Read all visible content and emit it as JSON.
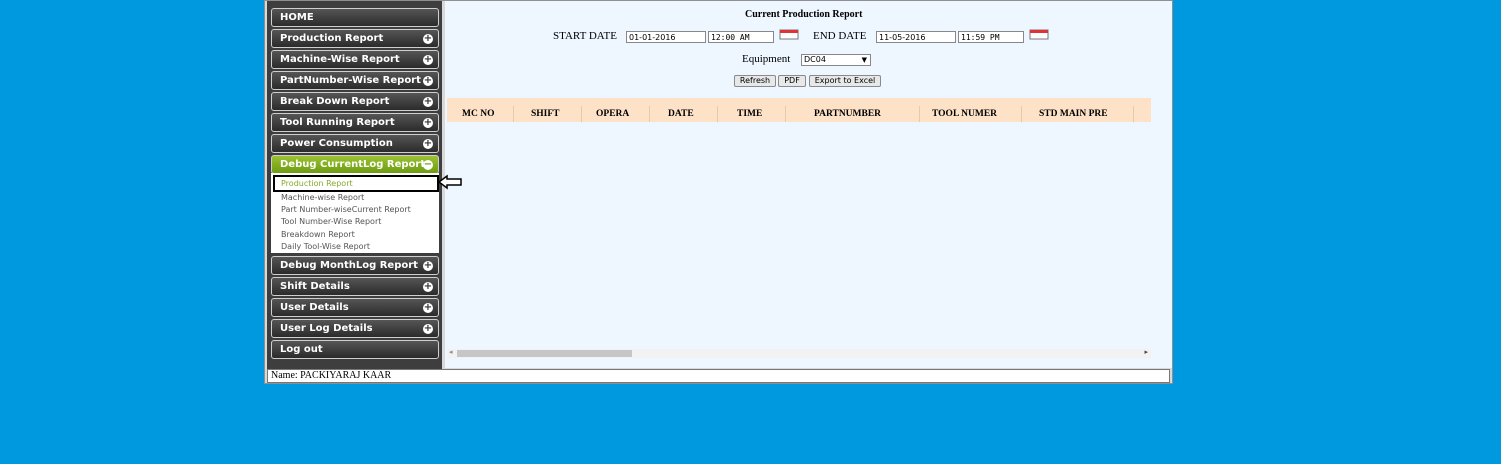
{
  "sidebar": {
    "home": "HOME",
    "items": [
      "Production Report",
      "Machine-Wise Report",
      "PartNumber-Wise Report",
      "Break Down Report",
      "Tool Running Report",
      "Power Consumption",
      "Debug CurrentLog Report"
    ],
    "submenu": [
      "Production Report",
      "Machine-wise Report",
      "Part Number-wiseCurrent Report",
      "Tool Number-Wise Report",
      "Breakdown Report",
      "Daily Tool-Wise Report"
    ],
    "items_after": [
      "Debug MonthLog Report",
      "Shift Details",
      "User Details",
      "User Log Details"
    ],
    "logout": "Log out"
  },
  "main": {
    "title": "Current Production Report",
    "start_label": "START DATE",
    "start_date": "01-01-2016",
    "start_time": "12:00 AM",
    "end_label": "END DATE",
    "end_date": "11-05-2016",
    "end_time": "11:59 PM",
    "equipment_label": "Equipment",
    "equipment_value": "DC04",
    "buttons": {
      "refresh": "Refresh",
      "pdf": "PDF",
      "excel": "Export to Excel"
    },
    "columns": [
      "MC NO",
      "SHIFT",
      "OPERA",
      "DATE",
      "TIME",
      "PARTNUMBER",
      "TOOL NUMER",
      "STD MAIN PRE"
    ]
  },
  "footer": {
    "name": "Name: PACKIYARAJ KAAR"
  },
  "colors": {
    "background": "#0098de",
    "active_menu": "#7aa81c",
    "table_header": "#fde2c7"
  }
}
